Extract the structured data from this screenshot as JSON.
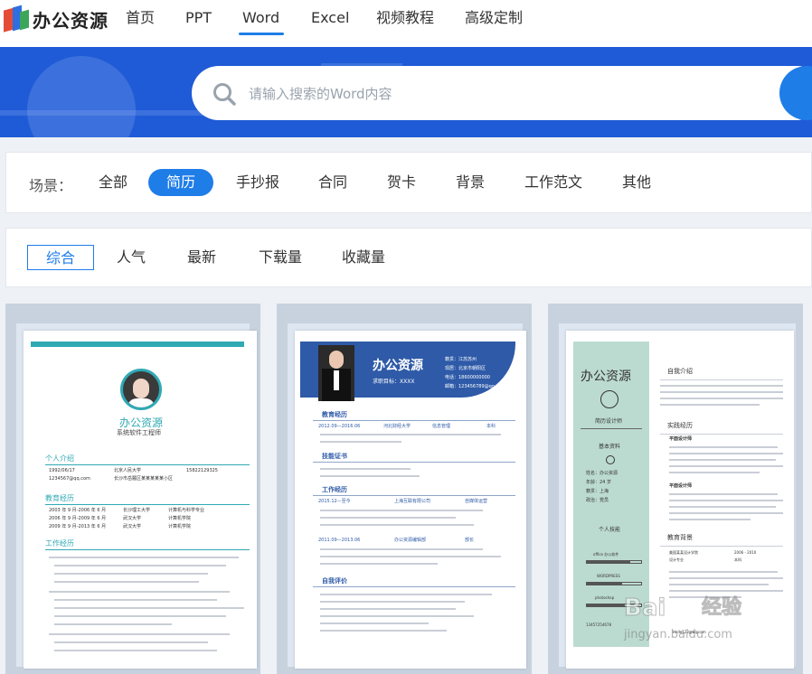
{
  "logo": {
    "text": "办公资源"
  },
  "nav": {
    "items": [
      "首页",
      "PPT",
      "Word",
      "Excel",
      "视频教程",
      "高级定制"
    ],
    "active": "Word"
  },
  "search": {
    "placeholder": "请输入搜索的Word内容"
  },
  "scene": {
    "label": "场景：",
    "items": [
      "全部",
      "简历",
      "手抄报",
      "合同",
      "贺卡",
      "背景",
      "工作范文",
      "其他"
    ],
    "active": "简历"
  },
  "sort": {
    "items": [
      "综合",
      "人气",
      "最新",
      "下载量",
      "收藏量"
    ],
    "active": "综合"
  },
  "cards": [
    {
      "name": "办公资源",
      "subtitle": "系统软件工程师",
      "sections": [
        "个人介绍",
        "教育经历",
        "工作经历"
      ],
      "info": [
        "1992/06/17",
        "1234567@qq.com",
        "北京人民大学",
        "15822129325",
        "长沙市岳麓区某某某某某小区"
      ],
      "edu": [
        [
          "2003 年 9 月-2006 年 6 月",
          "长沙理工大学",
          "计算机与科学专业"
        ],
        [
          "2006 年 9 月-2009 年 6 月",
          "武汉大学",
          "计算机学院"
        ],
        [
          "2009 年 9 月-2013 年 6 月",
          "武汉大学",
          "计算机学院"
        ]
      ]
    },
    {
      "name": "办公资源",
      "goal": "求职目标：XXXX",
      "contacts": [
        "籍贯：江苏苏州",
        "现居：北京市朝阳区",
        "电话：18600000000",
        "邮箱：123456789@qq.com"
      ],
      "sections": [
        "教育经历",
        "技能证书",
        "工作经历",
        "自我评价"
      ],
      "edu_row": [
        "2012.09—2016.06",
        "河北财经大学",
        "信息管理",
        "本科"
      ],
      "work_rows": [
        [
          "2015.12—至今",
          "上海互联有限公司",
          "自媒体运营"
        ],
        [
          "2011.09—2013.06",
          "办公资源编辑部",
          "部长"
        ]
      ]
    },
    {
      "name": "办公资源",
      "title": "简历设计师",
      "left_sections": [
        "基本资料",
        "个人技能"
      ],
      "basic": [
        "姓名：办公资源",
        "年龄：24 岁",
        "籍贯：上海",
        "政治：党员"
      ],
      "skills": [
        "office 办公软件",
        "WORDPRESS",
        "photoshop"
      ],
      "right_sections": [
        "自我介绍",
        "实践经历",
        "教育背景"
      ],
      "exp": [
        "平面设计师",
        "平面设计师"
      ],
      "edu": [
        "美国某某设计学院",
        "设计专业",
        "2006 - 2010",
        "本科"
      ],
      "phone": "13457254678",
      "email": "Hello123@bq.com"
    }
  ],
  "watermark": {
    "text1": "Bai",
    "text2": "经验",
    "url": "jingyan.baidu.com"
  },
  "colors": {
    "accent": "#1f7de8",
    "banner": "#1f5bd6",
    "card_bg": "#c8d2df",
    "resume_blue": "#2e5aa8",
    "resume_teal": "#2fa9b4",
    "resume_green": "#bcdbd0"
  }
}
